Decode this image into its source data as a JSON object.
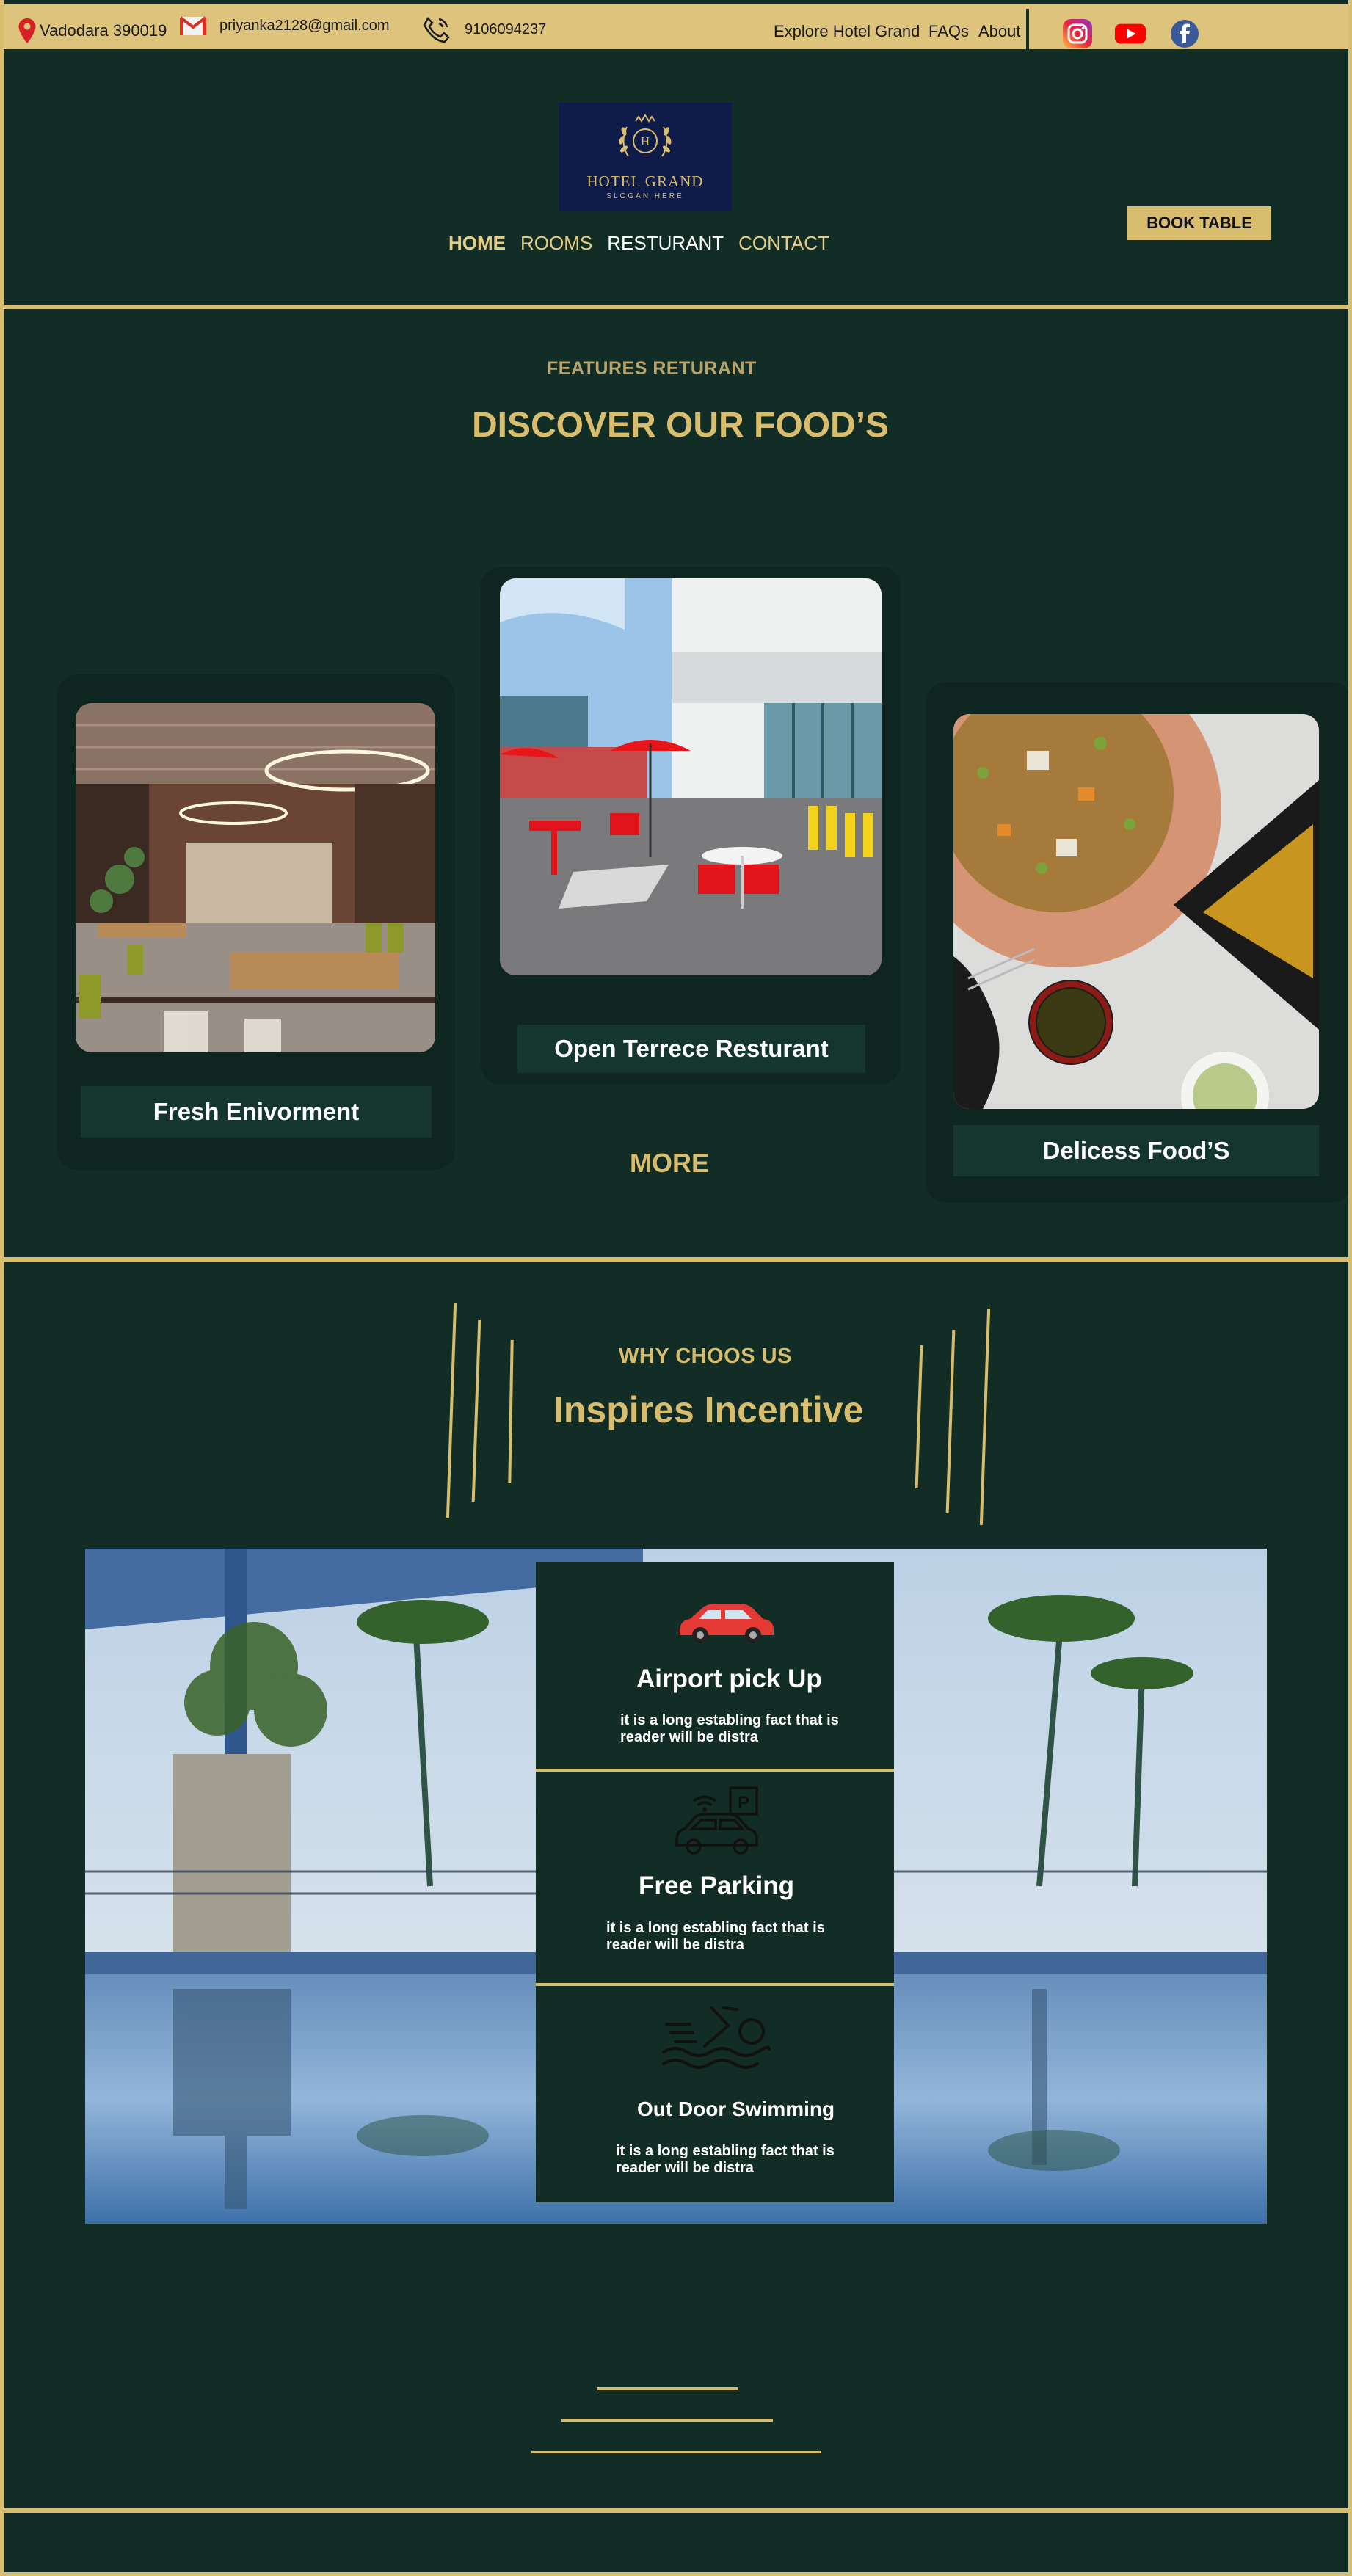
{
  "topbar": {
    "location": "Vadodara 390019",
    "email": "priyanka2128@gmail.com",
    "phone": "9106094237",
    "links": [
      "Explore Hotel Grand",
      "FAQs",
      "About"
    ]
  },
  "logo": {
    "monogram": "H",
    "brand": "HOTEL GRAND",
    "slogan": "SLOGAN HERE"
  },
  "nav": {
    "items": [
      "HOME",
      "ROOMS",
      "RESTURANT",
      "CONTACT"
    ],
    "active": "HOME"
  },
  "header": {
    "book_label": "BOOK TABLE"
  },
  "food": {
    "eyebrow": "FEATURES RETURANT",
    "title": "DISCOVER OUR FOOD’S",
    "cards": [
      {
        "label": "Fresh  Enivorment"
      },
      {
        "label": "Open Terrece Resturant"
      },
      {
        "label": "Delicess Food’S"
      }
    ],
    "more_label": "MORE"
  },
  "why": {
    "eyebrow": "WHY CHOOS US",
    "title": "Inspires Incentive",
    "features": [
      {
        "title": "Airport pick Up",
        "desc": "it is a long establing fact that is reader will be distra",
        "icon": "car-icon"
      },
      {
        "title": "Free Parking",
        "desc": "it is a long establing fact that is reader will be distra",
        "icon": "parking-icon"
      },
      {
        "title": "Out Door Swimming",
        "desc": "it is a long establing fact that is reader will be distra",
        "icon": "swimming-icon"
      }
    ]
  },
  "colors": {
    "background": "#122c26",
    "gold": "#d9bd6e",
    "navy": "#0f1c4a"
  }
}
